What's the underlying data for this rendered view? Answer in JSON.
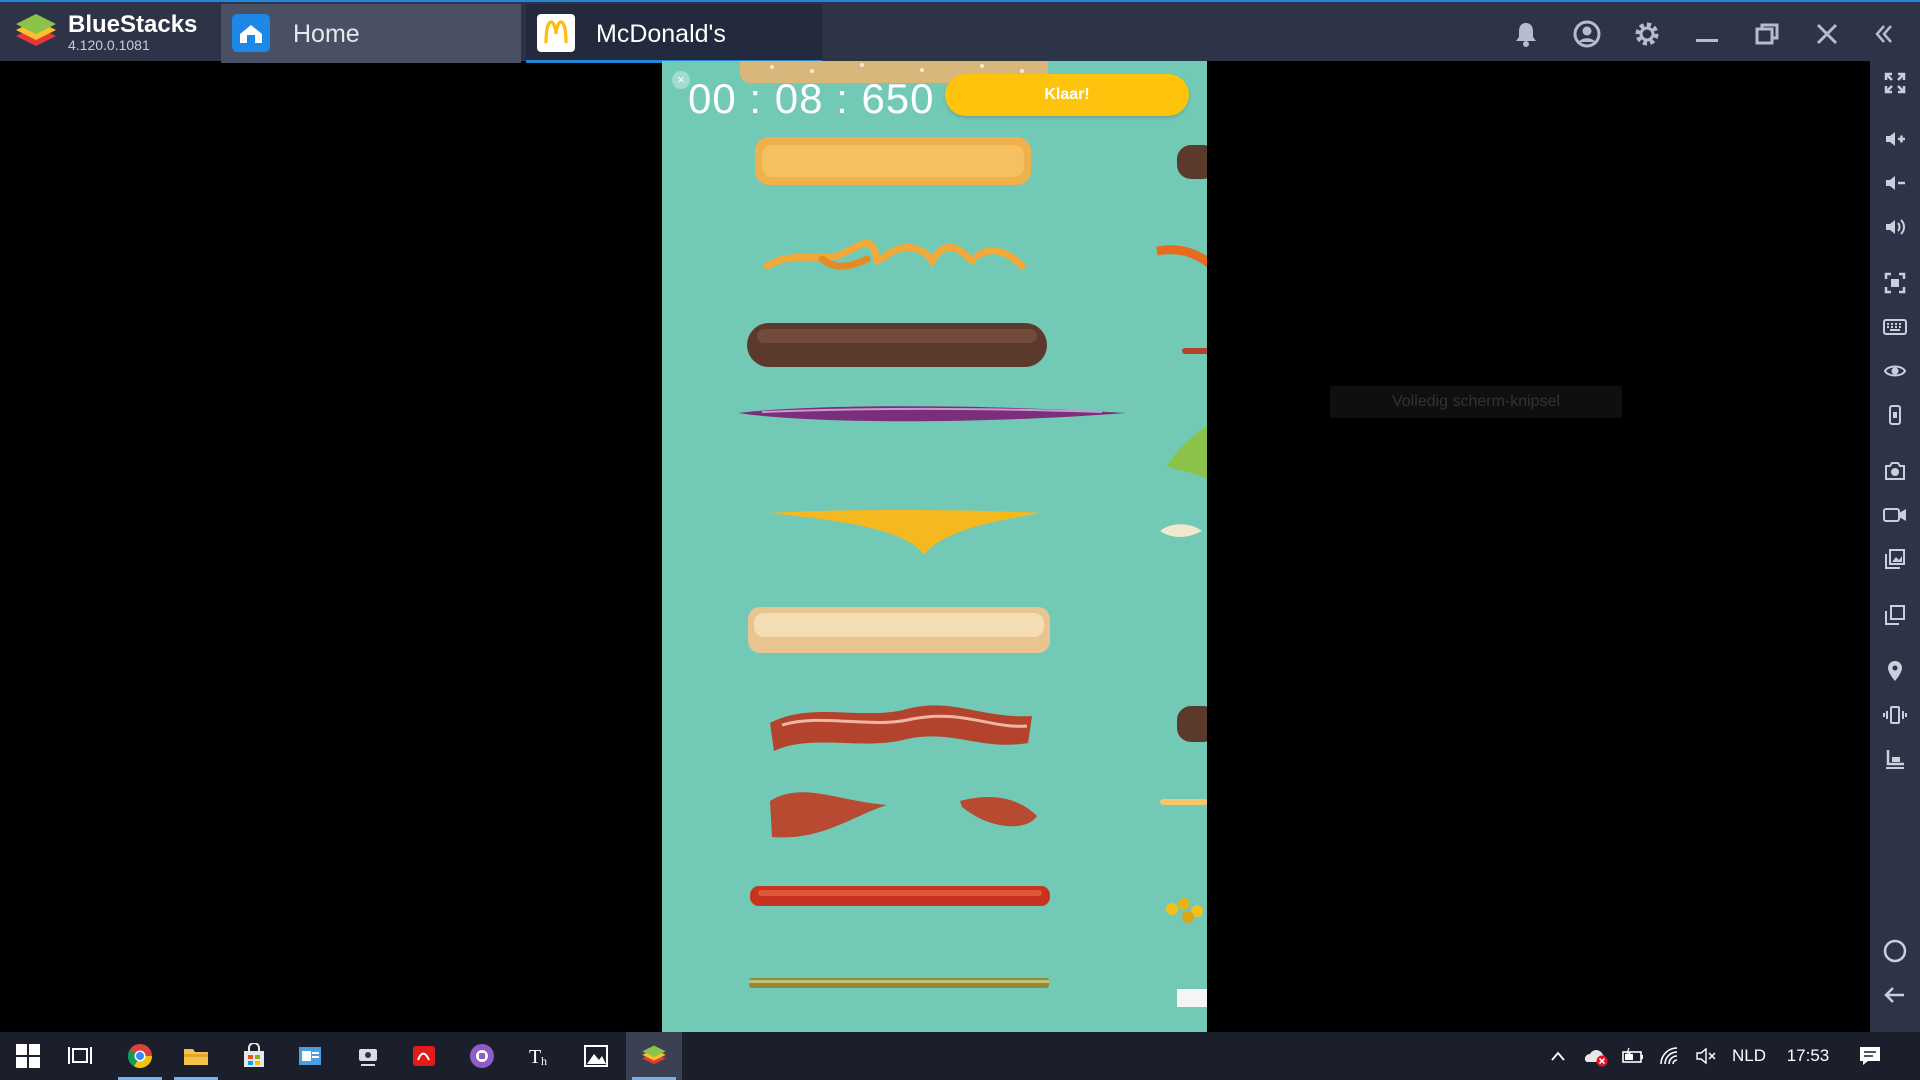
{
  "app": {
    "brand": "BlueStacks",
    "version": "4.120.0.1081",
    "accent_color": "#1f86d8"
  },
  "tabs": [
    {
      "label": "Home",
      "icon": "home-icon"
    },
    {
      "label": "McDonald's",
      "icon": "mcdonalds-logo-icon"
    }
  ],
  "window_controls": [
    "bell-icon",
    "account-icon",
    "gear-icon",
    "minimize-icon",
    "restore-icon",
    "close-icon",
    "collapse-sidebar-icon"
  ],
  "sidebar_tools": [
    "fullscreen-icon",
    "volume-up-icon",
    "volume-down-icon",
    "volume-icon",
    "screenshot-region-icon",
    "keyboard-icon",
    "eye-icon",
    "phone-rotate-icon",
    "camera-icon",
    "video-record-icon",
    "media-gallery-icon",
    "multi-instance-icon",
    "location-pin-icon",
    "shake-icon",
    "resize-icon",
    "home-circle-icon",
    "back-arrow-icon"
  ],
  "game": {
    "timer": "00 : 08 : 650",
    "done_label": "Klaar!",
    "background": "#72c9b5",
    "ingredients": [
      "bun-crown",
      "hash-brown",
      "crispy-onions",
      "beef-patty",
      "red-onion",
      "cheese-slice",
      "bun-heel",
      "bacon-strip",
      "bacon-pieces",
      "tomato-slices",
      "pickle-slices"
    ]
  },
  "snip_tooltip": "Volledig scherm-knipsel",
  "taskbar": {
    "apps": [
      "windows-start-icon",
      "task-view-icon",
      "chrome-icon",
      "file-explorer-icon",
      "store-icon",
      "outlook-icon",
      "network-sync-icon",
      "adobe-icon",
      "media-player-icon",
      "typora-icon",
      "photos-icon",
      "bluestacks-icon"
    ],
    "language": "NLD",
    "time": "17:53"
  }
}
